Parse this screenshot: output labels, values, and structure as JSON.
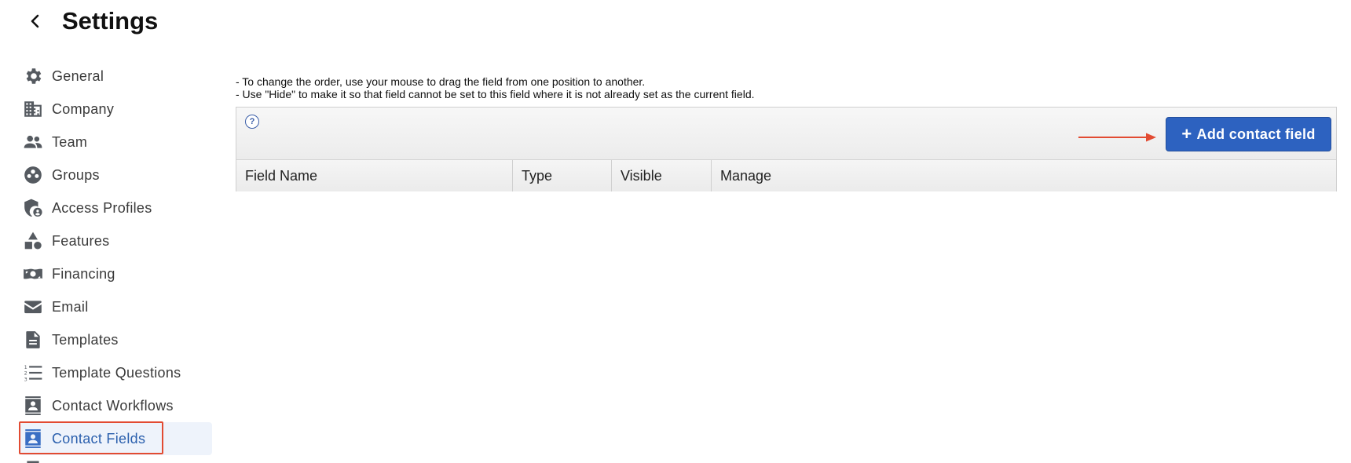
{
  "header": {
    "title": "Settings"
  },
  "sidebar": {
    "items": [
      {
        "label": "General",
        "icon": "gear-icon"
      },
      {
        "label": "Company",
        "icon": "building-icon"
      },
      {
        "label": "Team",
        "icon": "people-icon"
      },
      {
        "label": "Groups",
        "icon": "groups-icon"
      },
      {
        "label": "Access Profiles",
        "icon": "shield-user-icon"
      },
      {
        "label": "Features",
        "icon": "shapes-icon"
      },
      {
        "label": "Financing",
        "icon": "money-icon"
      },
      {
        "label": "Email",
        "icon": "envelope-icon"
      },
      {
        "label": "Templates",
        "icon": "document-icon"
      },
      {
        "label": "Template Questions",
        "icon": "numbered-list-icon"
      },
      {
        "label": "Contact Workflows",
        "icon": "contact-book-icon"
      },
      {
        "label": "Contact Fields",
        "icon": "contact-book-icon"
      }
    ],
    "active": "Contact Fields"
  },
  "main": {
    "instructions": [
      "- To change the order, use your mouse to drag the field from one position to another.",
      "- Use \"Hide\" to make it so that field cannot be set to this field where it is not already set as the current field."
    ],
    "help_label": "?",
    "add_button": {
      "plus": "+",
      "label": "Add contact field"
    },
    "columns": [
      "Field Name",
      "Type",
      "Visible",
      "Manage"
    ]
  },
  "colors": {
    "accent": "#2d62c0",
    "highlight": "#e24b32",
    "active_bg": "#eef3fb"
  }
}
